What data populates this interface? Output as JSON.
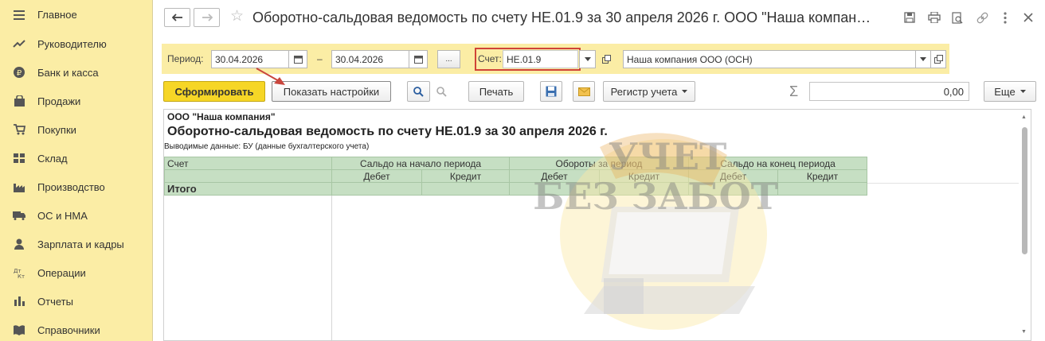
{
  "sidebar": {
    "items": [
      {
        "label": "Главное",
        "icon": "menu-icon"
      },
      {
        "label": "Руководителю",
        "icon": "trend-icon"
      },
      {
        "label": "Банк и касса",
        "icon": "ruble-icon"
      },
      {
        "label": "Продажи",
        "icon": "bag-icon"
      },
      {
        "label": "Покупки",
        "icon": "cart-icon"
      },
      {
        "label": "Склад",
        "icon": "warehouse-icon"
      },
      {
        "label": "Производство",
        "icon": "factory-icon"
      },
      {
        "label": "ОС и НМА",
        "icon": "truck-icon"
      },
      {
        "label": "Зарплата и кадры",
        "icon": "person-icon"
      },
      {
        "label": "Операции",
        "icon": "dt-kt-icon"
      },
      {
        "label": "Отчеты",
        "icon": "bar-chart-icon"
      },
      {
        "label": "Справочники",
        "icon": "book-icon"
      }
    ]
  },
  "header": {
    "title": "Оборотно-сальдовая ведомость по счету НЕ.01.9 за 30 апреля 2026 г. ООО \"Наша компан…"
  },
  "filters": {
    "period_label": "Период:",
    "date_from": "30.04.2026",
    "dash": "–",
    "date_to": "30.04.2026",
    "more_label": "...",
    "account_label": "Счет:",
    "account_value": "НЕ.01.9",
    "organization": "Наша компания ООО (ОСН)"
  },
  "toolbar": {
    "generate_label": "Сформировать",
    "settings_label": "Показать настройки",
    "print_label": "Печать",
    "register_label": "Регистр учета",
    "sum_symbol": "Σ",
    "sum_value": "0,00",
    "more_label": "Еще"
  },
  "report": {
    "org": "ООО \"Наша компания\"",
    "title": "Оборотно-сальдовая ведомость по счету НЕ.01.9 за 30 апреля 2026 г.",
    "output_data": "Выводимые данные: БУ (данные бухгалтерского учета)",
    "col_account": "Счет",
    "col_opening": "Сальдо на начало периода",
    "col_turnover": "Обороты за период",
    "col_closing": "Сальдо на конец периода",
    "debit": "Дебет",
    "credit": "Кредит",
    "total": "Итого"
  },
  "watermark": {
    "line1": "УЧЕТ",
    "line2": "БЕЗ ЗАБОТ"
  }
}
